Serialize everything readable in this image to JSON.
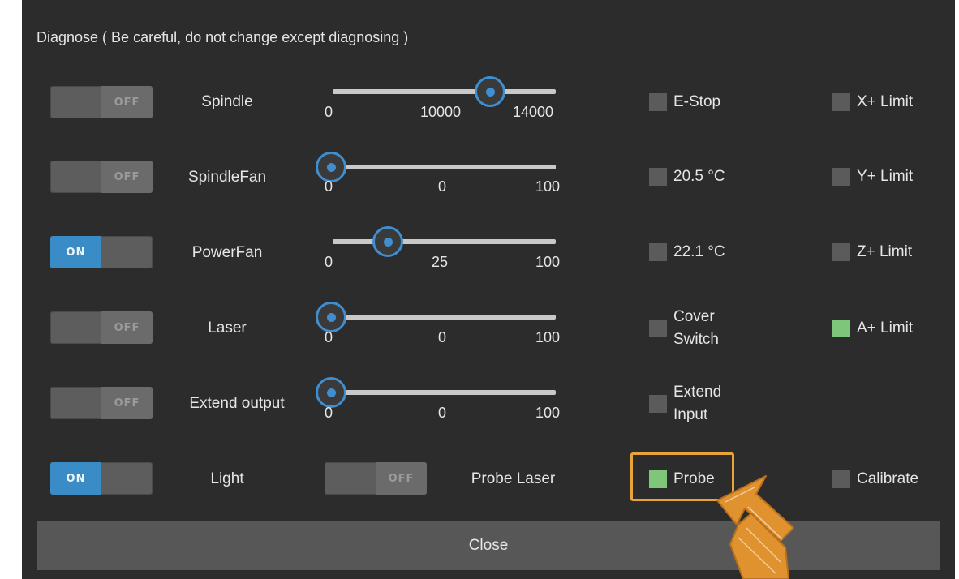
{
  "dialog": {
    "title": "Diagnose ( Be careful, do not change except diagnosing )"
  },
  "controls": [
    {
      "toggle": "OFF",
      "label": "Spindle",
      "slider": {
        "min": "0",
        "value": "10000",
        "max": "14000",
        "fraction": 0.714
      }
    },
    {
      "toggle": "OFF",
      "label": "SpindleFan",
      "slider": {
        "min": "0",
        "value": "0",
        "max": "100",
        "fraction": 0.0
      }
    },
    {
      "toggle": "ON",
      "label": "PowerFan",
      "slider": {
        "min": "0",
        "value": "25",
        "max": "100",
        "fraction": 0.25
      }
    },
    {
      "toggle": "OFF",
      "label": "Laser",
      "slider": {
        "min": "0",
        "value": "0",
        "max": "100",
        "fraction": 0.0
      }
    },
    {
      "toggle": "OFF",
      "label": "Extend output",
      "slider": {
        "min": "0",
        "value": "0",
        "max": "100",
        "fraction": 0.0
      }
    }
  ],
  "light": {
    "toggle": "ON",
    "label": "Light"
  },
  "probe_laser": {
    "toggle": "OFF",
    "label": "Probe Laser"
  },
  "inputs_col1": [
    {
      "line1": "E-Stop",
      "active": false
    },
    {
      "line1": "20.5 °C",
      "active": false
    },
    {
      "line1": "22.1 °C",
      "active": false
    },
    {
      "line1": "Cover",
      "line2": "Switch",
      "active": false
    },
    {
      "line1": "Extend",
      "line2": "Input",
      "active": false
    },
    {
      "line1": "Probe",
      "active": true
    }
  ],
  "inputs_col2": [
    {
      "label": "X+ Limit",
      "active": false
    },
    {
      "label": "Y+ Limit",
      "active": false
    },
    {
      "label": "Z+ Limit",
      "active": false
    },
    {
      "label": "A+ Limit",
      "active": true
    },
    {
      "label": "Calibrate",
      "active": false
    }
  ],
  "close_label": "Close",
  "colors": {
    "background": "#2c2c2c",
    "accent": "#3f8ed0",
    "active_indicator": "#7ec77a",
    "highlight": "#e8a33a"
  }
}
